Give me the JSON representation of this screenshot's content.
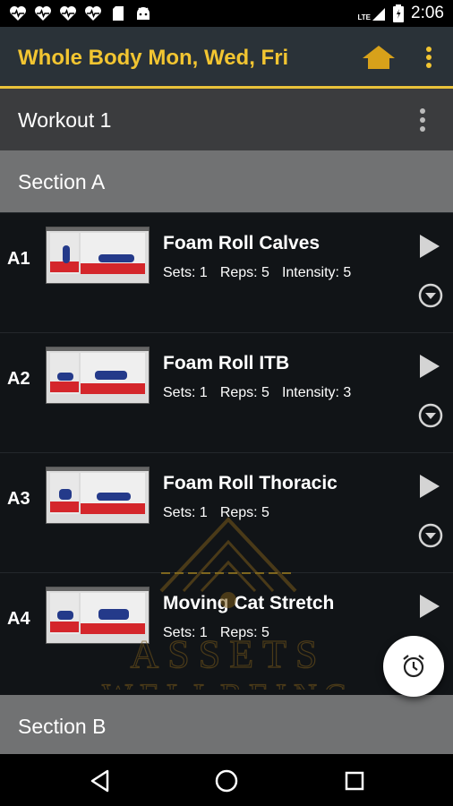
{
  "status_bar": {
    "time": "2:06",
    "network": "LTE"
  },
  "app_bar": {
    "title": "Whole Body Mon, Wed, Fri",
    "home_icon": "home-icon",
    "more_icon": "more-vert-icon",
    "accent": "#f2c531"
  },
  "workout": {
    "label": "Workout 1"
  },
  "sections": [
    {
      "label": "Section A"
    },
    {
      "label": "Section B"
    }
  ],
  "exercises": [
    {
      "code": "A1",
      "name": "Foam Roll Calves",
      "sets": "Sets: 1",
      "reps": "Reps: 5",
      "intensity": "Intensity: 5"
    },
    {
      "code": "A2",
      "name": "Foam Roll ITB",
      "sets": "Sets: 1",
      "reps": "Reps: 5",
      "intensity": "Intensity: 3"
    },
    {
      "code": "A3",
      "name": "Foam Roll Thoracic",
      "sets": "Sets: 1",
      "reps": "Reps: 5",
      "intensity": ""
    },
    {
      "code": "A4",
      "name": "Moving Cat Stretch",
      "sets": "Sets: 1",
      "reps": "Reps: 5",
      "intensity": ""
    }
  ],
  "watermark": {
    "line1": "ASSETS",
    "line2": "WELLBEING"
  },
  "fab": {
    "icon": "alarm-clock-icon"
  },
  "nav": {
    "back_icon": "back-icon",
    "home_icon": "home-circle-icon",
    "recents_icon": "recents-icon"
  }
}
